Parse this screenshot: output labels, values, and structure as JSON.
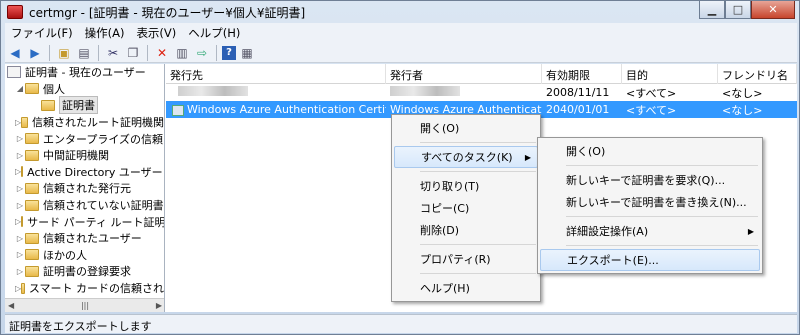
{
  "window": {
    "title": "certmgr - [証明書 - 現在のユーザー¥個人¥証明書]"
  },
  "menubar": [
    "ファイル(F)",
    "操作(A)",
    "表示(V)",
    "ヘルプ(H)"
  ],
  "toolbar": {
    "icons": [
      "back-icon",
      "forward-icon",
      "up-icon",
      "show-hide-tree-icon",
      "cut-icon",
      "copy-icon",
      "delete-icon",
      "properties-icon",
      "export-list-icon",
      "help-icon",
      "console-icon"
    ]
  },
  "tree": {
    "root": "証明書 - 現在のユーザー",
    "personal": "個人",
    "certificates": "証明書",
    "items": [
      "信頼されたルート証明機関",
      "エンタープライズの信頼",
      "中間証明機関",
      "Active Directory ユーザー オ",
      "信頼された発行元",
      "信頼されていない証明書",
      "サード パーティ ルート証明",
      "信頼されたユーザー",
      "ほかの人",
      "証明書の登録要求",
      "スマート カードの信頼され"
    ]
  },
  "list": {
    "columns": [
      "発行先",
      "発行者",
      "有効期限",
      "目的",
      "フレンドリ名"
    ],
    "rows": [
      {
        "issued_to": "",
        "issued_by": "",
        "expires": "2008/11/11",
        "purpose": "<すべて>",
        "friendly": "<なし>"
      },
      {
        "issued_to": "Windows Azure Authentication Certificate",
        "issued_by": "Windows Azure Authenticatio...",
        "expires": "2040/01/01",
        "purpose": "<すべて>",
        "friendly": "<なし>"
      }
    ]
  },
  "context_menu": {
    "open": "開く(O)",
    "all_tasks": "すべてのタスク(K)",
    "cut": "切り取り(T)",
    "copy": "コピー(C)",
    "delete": "削除(D)",
    "properties": "プロパティ(R)",
    "help": "ヘルプ(H)"
  },
  "submenu": {
    "open": "開く(O)",
    "request_new_key": "新しいキーで証明書を要求(Q)...",
    "renew_new_key": "新しいキーで証明書を書き換え(N)...",
    "advanced": "詳細設定操作(A)",
    "export": "エクスポート(E)..."
  },
  "status": "証明書をエクスポートします"
}
